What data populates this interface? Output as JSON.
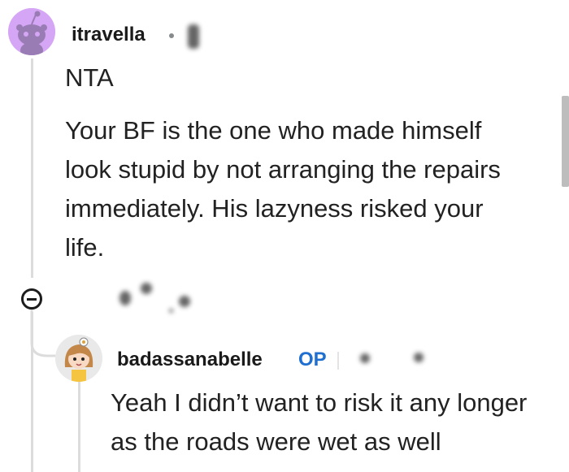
{
  "comment": {
    "username": "itravella",
    "avatar_icon": "reddit-snoo-avatar-icon",
    "body_short": "NTA",
    "body_lines": [
      "Your BF is the one who made himself",
      "look stupid by not arranging the repairs",
      "immediately. His lazyness risked your",
      "life."
    ]
  },
  "collapse": {
    "icon": "collapse-minus-icon"
  },
  "reply": {
    "username": "badassanabelle",
    "op_badge": "OP",
    "avatar_icon": "cartoon-girl-avatar-icon",
    "body_lines": [
      "Yeah I didn’t want to risk it any longer",
      "as the roads were wet as well"
    ]
  },
  "colors": {
    "op_blue": "#1f6fd1",
    "avatar_purple": "#d5a6f5",
    "thread_line": "#dcdcdc"
  }
}
